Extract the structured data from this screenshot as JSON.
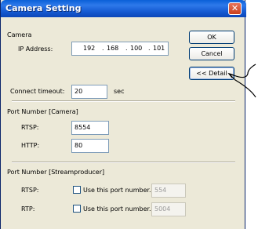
{
  "window": {
    "title": "Camera Setting",
    "close_symbol": "✕"
  },
  "camera": {
    "section_label": "Camera",
    "ip_label": "IP Address:",
    "ip_octets": [
      "192",
      "168",
      "100",
      "101"
    ],
    "ip_separator": ".",
    "timeout_label": "Connect timeout:",
    "timeout_value": "20",
    "timeout_unit": "sec"
  },
  "buttons": {
    "ok": "OK",
    "cancel": "Cancel",
    "details": "<< Detail"
  },
  "port_camera": {
    "section_label": "Port Number [Camera]",
    "rtsp_label": "RTSP:",
    "rtsp_value": "8554",
    "http_label": "HTTP:",
    "http_value": "80"
  },
  "port_stream": {
    "section_label": "Port Number [Streamproducer]",
    "rtsp_label": "RTSP:",
    "rtsp_checkbox_label": "Use this port number.",
    "rtsp_value": "554",
    "rtp_label": "RTP:",
    "rtp_checkbox_label": "Use this port number.",
    "rtp_value": "5004"
  },
  "icons": {
    "close": "close-icon",
    "callout": "callout-arrow-icon"
  }
}
